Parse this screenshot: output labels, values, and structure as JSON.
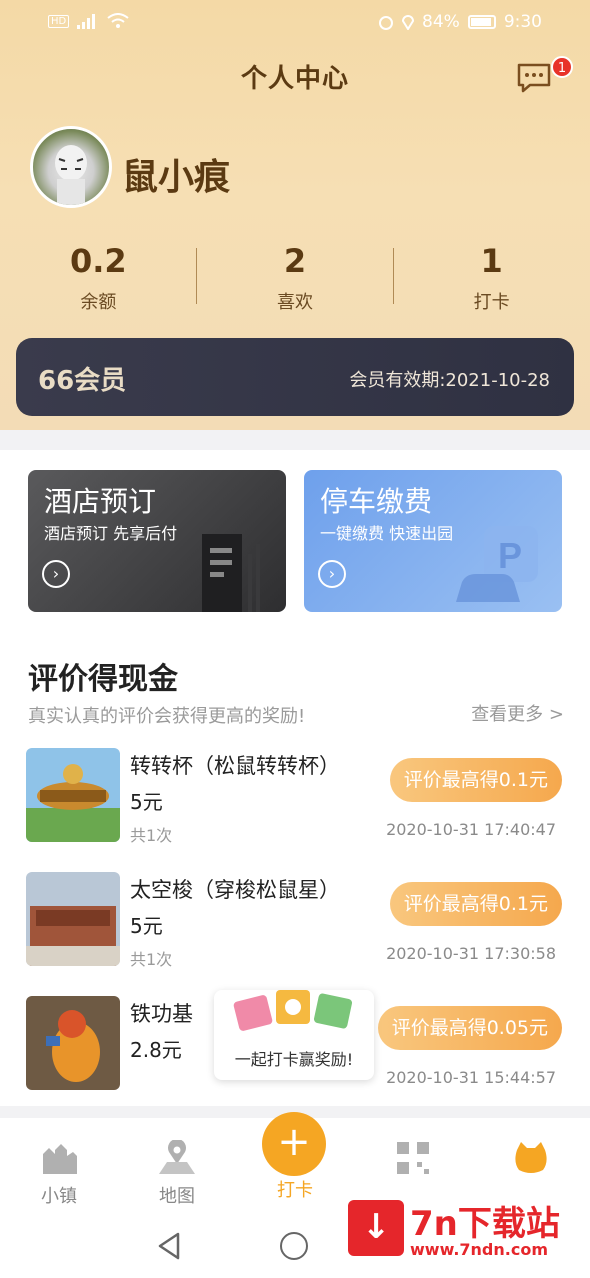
{
  "status_bar": {
    "battery": "84%",
    "time": "9:30",
    "network": "4G"
  },
  "header": {
    "title": "个人中心",
    "message_badge": "1"
  },
  "profile": {
    "username": "鼠小痕"
  },
  "stats": [
    {
      "value": "0.2",
      "label": "余额"
    },
    {
      "value": "2",
      "label": "喜欢"
    },
    {
      "value": "1",
      "label": "打卡"
    }
  ],
  "member": {
    "name": "66会员",
    "expiry": "会员有效期:2021-10-28"
  },
  "promos": [
    {
      "title": "酒店预订",
      "subtitle": "酒店预订 先享后付"
    },
    {
      "title": "停车缴费",
      "subtitle": "一键缴费  快速出园"
    }
  ],
  "reviews": {
    "title": "评价得现金",
    "subtitle": "真实认真的评价会获得更高的奖励!",
    "more": "查看更多 >",
    "items": [
      {
        "name": "转转杯（松鼠转转杯）",
        "price": "5元",
        "count": "共1次",
        "reward": "评价最高得0.1元",
        "time": "2020-10-31 17:40:47"
      },
      {
        "name": "太空梭（穿梭松鼠星）",
        "price": "5元",
        "count": "共1次",
        "reward": "评价最高得0.1元",
        "time": "2020-10-31 17:30:58"
      },
      {
        "name": "铁功基",
        "price": "2.8元",
        "count": "",
        "reward": "评价最高得0.05元",
        "time": "2020-10-31 15:44:57"
      }
    ]
  },
  "floating_promo": {
    "text": "一起打卡赢奖励!"
  },
  "tabbar": [
    {
      "label": "小镇"
    },
    {
      "label": "地图"
    },
    {
      "label": "打卡"
    }
  ],
  "watermark": {
    "title": "7n下载站",
    "url": "www.7ndn.com"
  }
}
